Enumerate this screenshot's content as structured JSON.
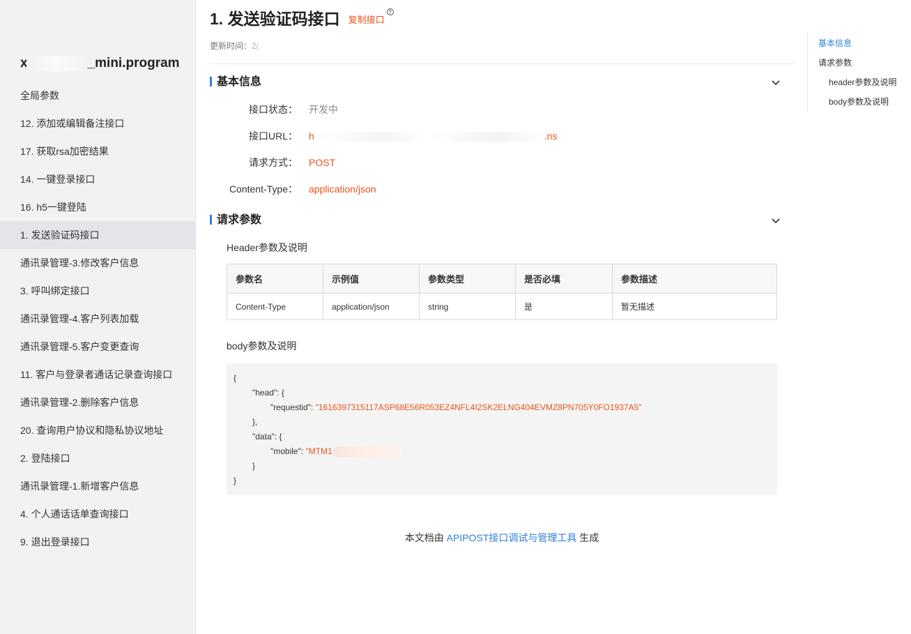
{
  "sidebar": {
    "project_name_start": "x",
    "project_name_end": "_mini.program",
    "items": [
      {
        "label": "全局参数"
      },
      {
        "label": "12. 添加或编辑备注接口"
      },
      {
        "label": "17. 获取rsa加密结果"
      },
      {
        "label": "14. 一键登录接口"
      },
      {
        "label": "16. h5一键登陆"
      },
      {
        "label": "1. 发送验证码接口",
        "active": true
      },
      {
        "label": "通讯录管理-3.修改客户信息"
      },
      {
        "label": "3. 呼叫绑定接口"
      },
      {
        "label": "通讯录管理-4.客户列表加载"
      },
      {
        "label": "通讯录管理-5.客户变更查询"
      },
      {
        "label": "11. 客户与登录者通话记录查询接口"
      },
      {
        "label": "通讯录管理-2.删除客户信息"
      },
      {
        "label": "20. 查询用户协议和隐私协议地址"
      },
      {
        "label": "2. 登陆接口"
      },
      {
        "label": "通讯录管理-1.新增客户信息"
      },
      {
        "label": "4. 个人通话话单查询接口"
      },
      {
        "label": "9. 退出登录接口"
      }
    ]
  },
  "header": {
    "title": "1. 发送验证码接口",
    "copy_label": "复制接口",
    "help_icon": "question-circle-icon",
    "update_time": "更新时间：2("
  },
  "basic_info": {
    "section_title": "基本信息",
    "status_key": "接口状态：",
    "status_value": "开发中",
    "url_key": "接口URL：",
    "url_prefix": "h",
    "url_suffix": ".ns",
    "method_key": "请求方式：",
    "method_value": "POST",
    "content_type_key": "Content-Type：",
    "content_type_value": "application/json"
  },
  "request_params": {
    "section_title": "请求参数",
    "header_label": "Header参数及说明",
    "columns": [
      "参数名",
      "示例值",
      "参数类型",
      "是否必填",
      "参数描述"
    ],
    "rows": [
      [
        "Content-Type",
        "application/json",
        "string",
        "是",
        "暂无描述"
      ]
    ],
    "body_label": "body参数及说明",
    "body": {
      "open": "{",
      "head_key": "\"head\": {",
      "requestid_key": "\"requestid\": ",
      "requestid_value": "\"1616397315117ASP68E56R053EZ4NFL4I2SK2ELNG404EVMZ8PN705Y0FO1937A5\"",
      "head_close": "},",
      "data_key": "\"data\": {",
      "mobile_key": "\"mobile\": ",
      "mobile_value": "\"MTM1",
      "data_close": "}",
      "close": "}"
    }
  },
  "footer": {
    "prefix": "本文档由 ",
    "link": "APIPOST接口调试与管理工具",
    "suffix": " 生成"
  },
  "toc": {
    "items": [
      {
        "label": "基本信息",
        "active": true
      },
      {
        "label": "请求参数"
      },
      {
        "label": "header参数及说明"
      },
      {
        "label": "body参数及说明"
      }
    ]
  },
  "colors": {
    "accent": "#2f80d6",
    "orange": "#e8541b",
    "sidebar_bg": "#f2f2f2",
    "active_bg": "#e3e5e9"
  }
}
